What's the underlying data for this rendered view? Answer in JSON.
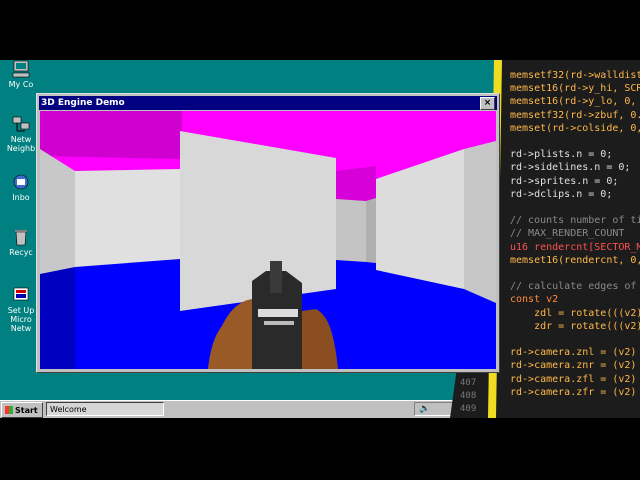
{
  "desktop_icons": [
    {
      "label": "My Co"
    },
    {
      "label": "Netw\nNeighb"
    },
    {
      "label": "Inbo"
    },
    {
      "label": "Recyc"
    },
    {
      "label": "Set Up\nMicro\nNetw"
    }
  ],
  "window": {
    "title": "3D Engine Demo",
    "close": "×"
  },
  "taskbar": {
    "start_label": "Start",
    "task_label": "Welcome"
  },
  "code": {
    "lines": [
      {
        "text": "memsetf32(rd->walldist",
        "kind": "fn"
      },
      {
        "text": "memset16(rd->y_hi, SCR",
        "kind": "fn"
      },
      {
        "text": "memset16(rd->y_lo, 0,",
        "kind": "fn"
      },
      {
        "text": "memsetf32(rd->zbuf, 0.",
        "kind": "fn"
      },
      {
        "text": "memset(rd->colside, 0,",
        "kind": "fn"
      },
      {
        "text": "",
        "kind": "plain"
      },
      {
        "text": "rd->plists.n = 0;",
        "kind": "plain"
      },
      {
        "text": "rd->sidelines.n = 0;",
        "kind": "plain"
      },
      {
        "text": "rd->sprites.n = 0;",
        "kind": "plain"
      },
      {
        "text": "rd->dclips.n = 0;",
        "kind": "plain"
      },
      {
        "text": "",
        "kind": "plain"
      },
      {
        "text": "// counts number of ti",
        "kind": "comment"
      },
      {
        "text": "// MAX_RENDER_COUNT",
        "kind": "comment"
      },
      {
        "text": "u16 rendercnt[SECTOR_M",
        "kind": "hl"
      },
      {
        "text": "memset16(rendercnt, 0,",
        "kind": "fn"
      },
      {
        "text": "",
        "kind": "plain"
      },
      {
        "text": "// calculate edges of",
        "kind": "comment"
      },
      {
        "text": "const v2",
        "kind": "keyword"
      },
      {
        "text": "    zdl = rotate(((v2)",
        "kind": "fn"
      },
      {
        "text": "    zdr = rotate(((v2)",
        "kind": "fn"
      },
      {
        "text": "",
        "kind": "plain"
      },
      {
        "text": "rd->camera.znl = (v2)",
        "kind": "fn"
      },
      {
        "text": "rd->camera.znr = (v2)",
        "kind": "fn"
      },
      {
        "text": "rd->camera.zfl = (v2)",
        "kind": "fn"
      },
      {
        "text": "rd->camera.zfr = (v2)",
        "kind": "fn"
      }
    ],
    "line_numbers": [
      "407",
      "408",
      "409"
    ]
  }
}
